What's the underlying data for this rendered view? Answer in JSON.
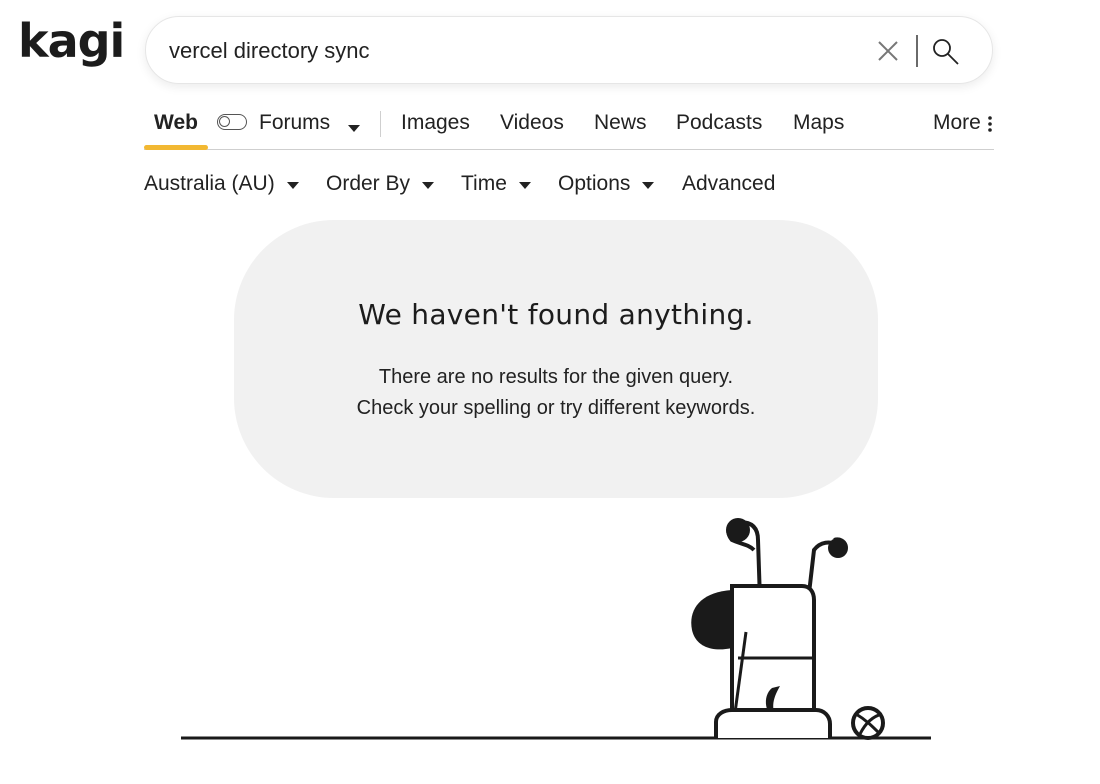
{
  "logo": {
    "text": "kagi"
  },
  "search": {
    "value": "vercel directory sync",
    "clear_icon": "close-icon",
    "search_icon": "search-icon"
  },
  "tabs": {
    "web": "Web",
    "forums": "Forums",
    "images": "Images",
    "videos": "Videos",
    "news": "News",
    "podcasts": "Podcasts",
    "maps": "Maps",
    "more": "More"
  },
  "filters": {
    "region": "Australia (AU)",
    "order_by": "Order By",
    "time": "Time",
    "options": "Options",
    "advanced": "Advanced"
  },
  "empty_state": {
    "title": "We haven't found anything.",
    "line1": "There are no results for the given query.",
    "line2": "Check your spelling or try different keywords."
  },
  "colors": {
    "accent": "#f2b832",
    "bubble": "#f1f1f1",
    "text": "#222222"
  }
}
